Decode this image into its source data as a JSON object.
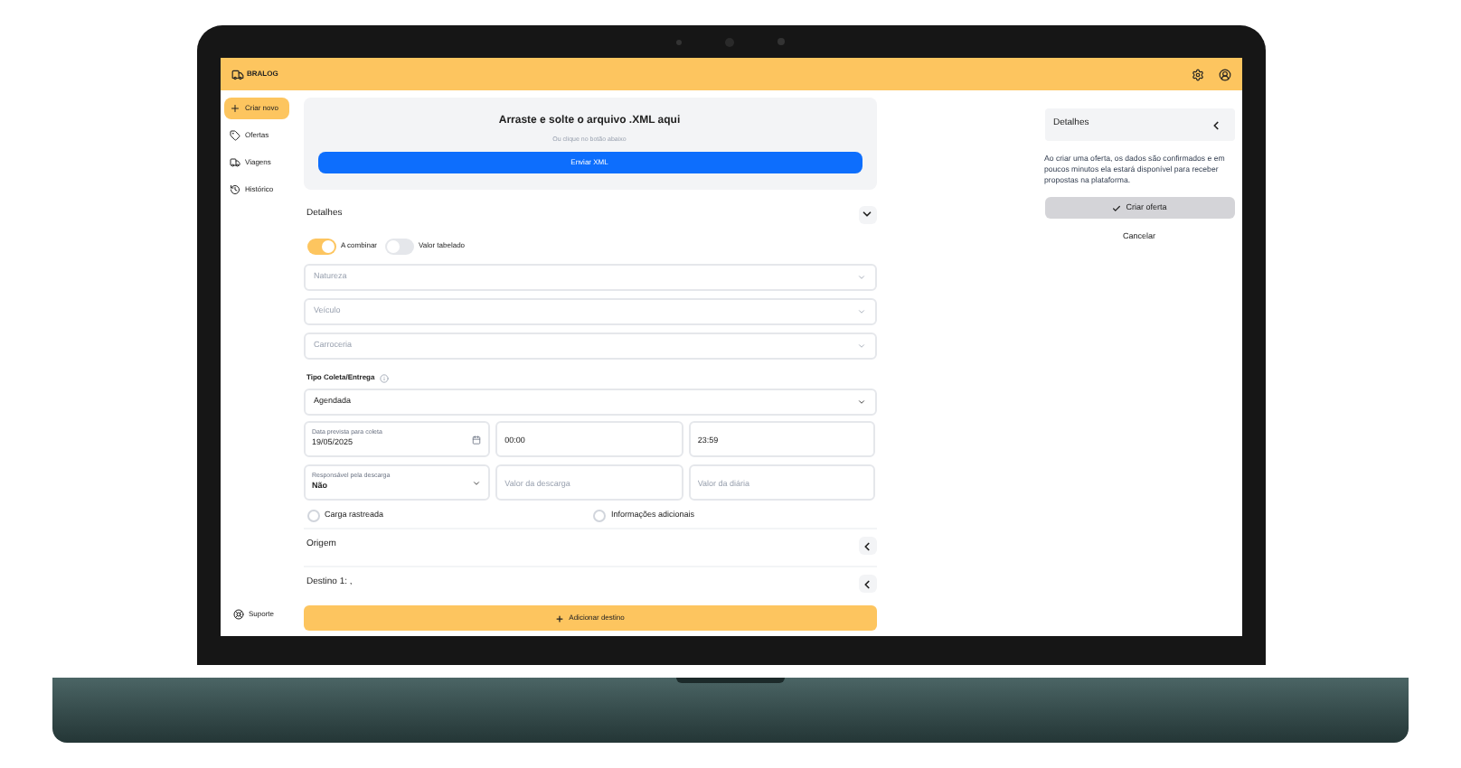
{
  "header": {
    "logo_text": "BRALOG"
  },
  "sidebar": {
    "items": [
      {
        "label": "Criar novo",
        "selected": true
      },
      {
        "label": "Ofertas",
        "selected": false
      },
      {
        "label": "Viagens",
        "selected": false
      },
      {
        "label": "Histórico",
        "selected": false
      }
    ],
    "footer": {
      "label": "Suporte"
    }
  },
  "upload": {
    "title": "Arraste e solte o arquivo .XML aqui",
    "hint": "Ou clique no botão abaixo",
    "button": "Enviar XML"
  },
  "details": {
    "title": "Detalhes",
    "expanded": true,
    "toggles": [
      {
        "label": "A combinar",
        "on": true
      },
      {
        "label": "Valor tabelado",
        "on": false
      }
    ],
    "selects": [
      {
        "placeholder": "Natureza"
      },
      {
        "placeholder": "Veículo"
      },
      {
        "placeholder": "Carroceria"
      }
    ],
    "type_label": "Tipo Coleta/Entrega",
    "type_select": {
      "value": "Agendada"
    },
    "date_field": {
      "label": "Data prevista para coleta",
      "value": "19/05/2025"
    },
    "time_fields": [
      {
        "value": "00:00"
      },
      {
        "value": "23:59"
      }
    ],
    "responsible_select": {
      "label": "Responsável pela descarga",
      "value": "Não"
    },
    "value_fields": [
      {
        "placeholder": "Valor da descarga"
      },
      {
        "placeholder": "Valor da diária"
      }
    ],
    "checkboxes": [
      {
        "label": "Carga rastreada",
        "checked": false
      },
      {
        "label": "Informações adicionais",
        "checked": false
      }
    ]
  },
  "sections": [
    {
      "title": "Origem",
      "expanded": false
    },
    {
      "title": "Destino 1: ,",
      "expanded": false
    }
  ],
  "add_button": "Adicionar destino",
  "summary": {
    "title": "Detalhes",
    "text": "Ao criar uma oferta, os dados são confirmados e em poucos minutos ela estará disponível para receber propostas na plataforma.",
    "primary": "Criar oferta",
    "secondary": "Cancelar"
  }
}
